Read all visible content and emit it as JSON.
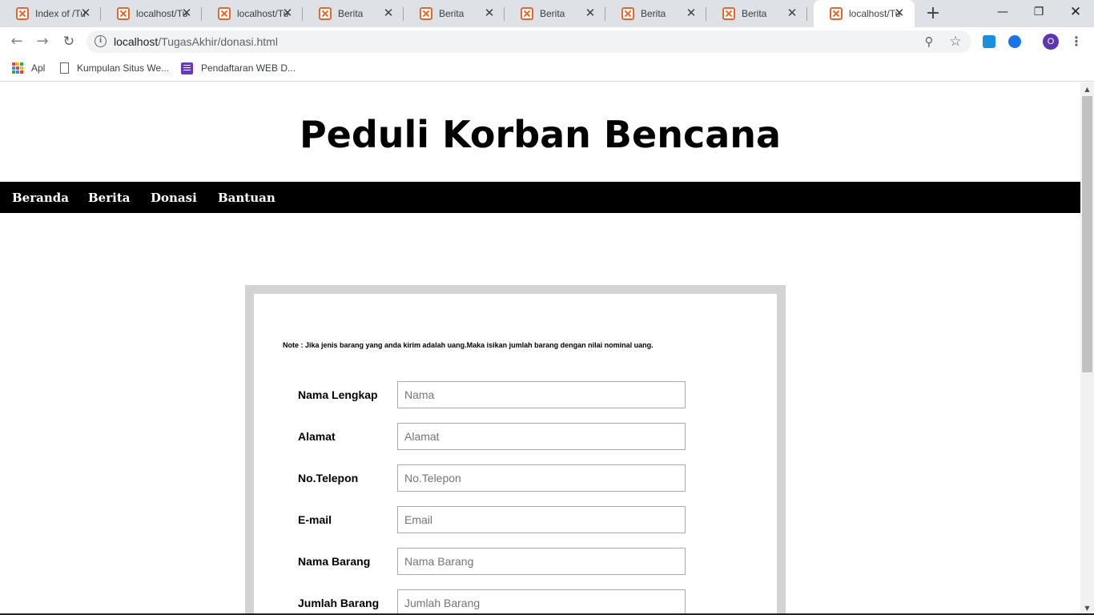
{
  "browser": {
    "tabs": [
      {
        "title": "Index of /Tu",
        "active": false
      },
      {
        "title": "localhost/Tu",
        "active": false
      },
      {
        "title": "localhost/Tu",
        "active": false
      },
      {
        "title": "Berita",
        "active": false
      },
      {
        "title": "Berita",
        "active": false
      },
      {
        "title": "Berita",
        "active": false
      },
      {
        "title": "Berita",
        "active": false
      },
      {
        "title": "Berita",
        "active": false
      },
      {
        "title": "localhost/Tu",
        "active": true
      }
    ],
    "url_host": "localhost",
    "url_path": "/TugasAkhir/donasi.html",
    "profile_initial": "O",
    "bookmarks": [
      {
        "label": "Apl",
        "icon": "apps-grid-icon"
      },
      {
        "label": "Kumpulan Situs We...",
        "icon": "page-icon"
      },
      {
        "label": "Pendaftaran WEB D...",
        "icon": "form-icon"
      }
    ]
  },
  "page": {
    "title": "Peduli Korban Bencana",
    "nav": [
      "Beranda",
      "Berita",
      "Donasi",
      "Bantuan"
    ],
    "note": "Note : Jika jenis barang yang anda kirim adalah uang.Maka isikan jumlah barang dengan nilai nominal uang.",
    "fields": [
      {
        "label": "Nama Lengkap",
        "placeholder": "Nama"
      },
      {
        "label": "Alamat",
        "placeholder": "Alamat"
      },
      {
        "label": "No.Telepon",
        "placeholder": "No.Telepon"
      },
      {
        "label": "E-mail",
        "placeholder": "Email"
      },
      {
        "label": "Nama Barang",
        "placeholder": "Nama Barang"
      },
      {
        "label": "Jumlah Barang",
        "placeholder": "Jumlah Barang"
      }
    ]
  },
  "colors": {
    "tabstrip": "#dee1e6",
    "favicon": "#e8652b",
    "nav_bg": "#000000",
    "frame": "#d3d3d3",
    "profile": "#5e35b1"
  }
}
